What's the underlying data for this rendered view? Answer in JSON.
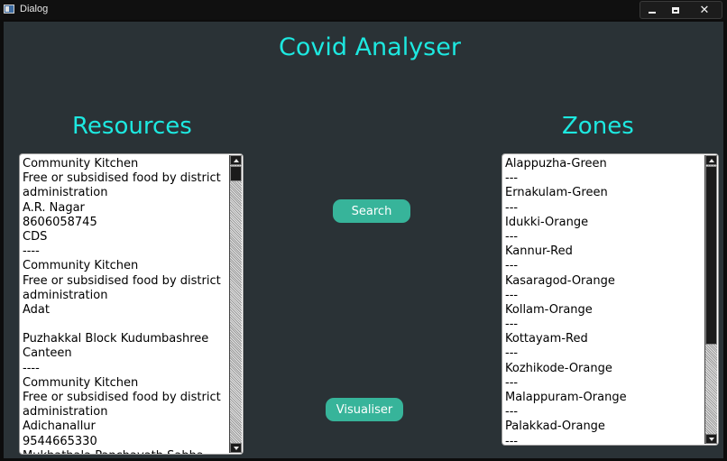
{
  "window": {
    "title": "Dialog"
  },
  "headings": {
    "app": "Covid Analyser",
    "resources": "Resources",
    "zones": "Zones"
  },
  "buttons": {
    "search": "Search",
    "visualiser": "Visualiser"
  },
  "resources_list": [
    " Community Kitchen",
    "Free or subsidised food by district",
    "administration",
    "A.R. Nagar",
    "8606058745",
    "CDS",
    "----",
    "Community Kitchen",
    "Free or subsidised food by district",
    "administration",
    "Adat",
    "",
    "Puzhakkal Block Kudumbashree",
    "Canteen",
    "----",
    "Community Kitchen",
    "Free or subsidised food by district",
    "administration",
    "Adichanallur",
    "9544665330",
    "Mukhathala Panchayath Sabha"
  ],
  "zones_list": [
    " Alappuzha-Green",
    "---",
    "Ernakulam-Green",
    "---",
    "Idukki-Orange",
    "---",
    "Kannur-Red",
    "---",
    "Kasaragod-Orange",
    "---",
    "Kollam-Orange",
    "---",
    "Kottayam-Red",
    "---",
    "Kozhikode-Orange",
    "---",
    "Malappuram-Orange",
    "---",
    "Palakkad-Orange",
    "---"
  ],
  "colors": {
    "accent": "#1de8e0",
    "button": "#37b49a",
    "background": "#2a3236"
  }
}
